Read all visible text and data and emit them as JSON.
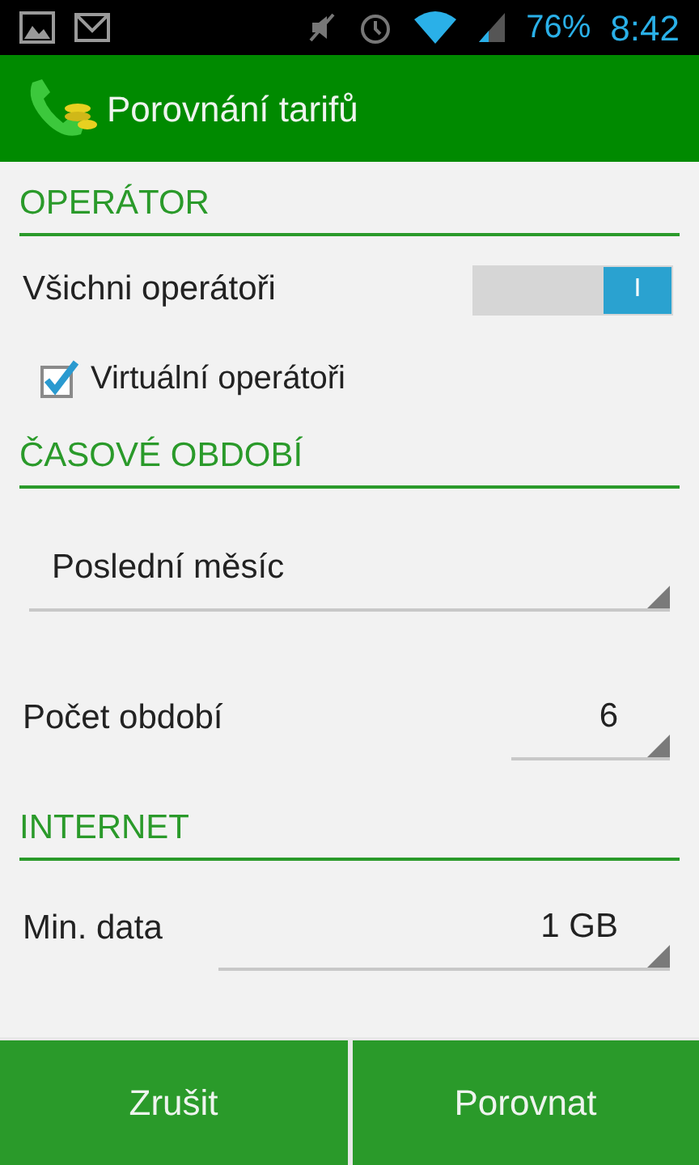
{
  "status_bar": {
    "battery": "76%",
    "time": "8:42"
  },
  "app_bar": {
    "title": "Porovnání tarifů"
  },
  "sections": [
    {
      "title": "OPERÁTOR",
      "items": [
        {
          "kind": "toggle",
          "label": "Všichni operátoři",
          "on": true,
          "toggle_text": "I"
        },
        {
          "kind": "checkbox",
          "label": "Virtuální operátoři",
          "checked": true
        }
      ]
    },
    {
      "title": "ČASOVÉ OBDOBÍ",
      "items": [
        {
          "kind": "dropdown",
          "value": "Poslední měsíc"
        },
        {
          "kind": "value",
          "label": "Počet období",
          "value": "6"
        }
      ]
    },
    {
      "title": "INTERNET",
      "items": [
        {
          "kind": "value_wide",
          "label": "Min. data",
          "value": "1 GB"
        }
      ]
    }
  ],
  "buttons": [
    "Zrušit",
    "Porovnat"
  ]
}
